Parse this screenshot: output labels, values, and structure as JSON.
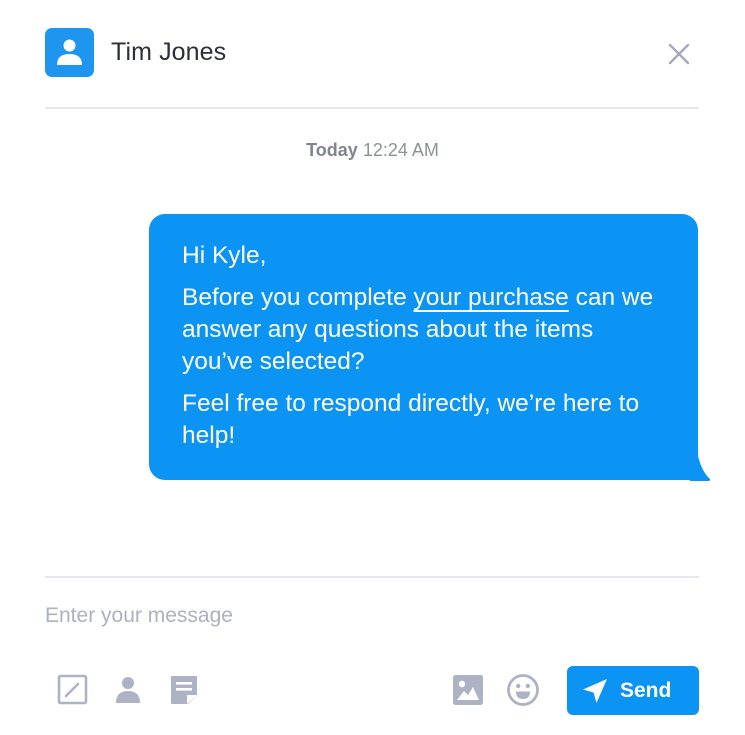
{
  "header": {
    "contact_name": "Tim Jones",
    "avatar_icon": "user-icon",
    "close_icon": "close-icon"
  },
  "conversation": {
    "timestamp_day": "Today",
    "timestamp_time": "12:24 AM",
    "message": {
      "greeting": "Hi Kyle,",
      "line2_before_link": "Before you complete ",
      "line2_link": "your purchase",
      "line2_after_link": " can we answer any questions about the items you’ve selected?",
      "line3": "Feel free to respond directly, we’re here to help!"
    }
  },
  "composer": {
    "placeholder": "Enter your message",
    "value": "",
    "left_tools": [
      "edit-icon",
      "user-icon",
      "note-icon"
    ],
    "right_tools": [
      "image-icon",
      "emoji-icon"
    ],
    "send_label": "Send",
    "send_icon": "paper-plane-icon"
  },
  "colors": {
    "accent": "#0b94f4",
    "icon_gray": "#aeb2c5",
    "divider": "#e6e8ef",
    "text_dark": "#2c2f3a"
  }
}
